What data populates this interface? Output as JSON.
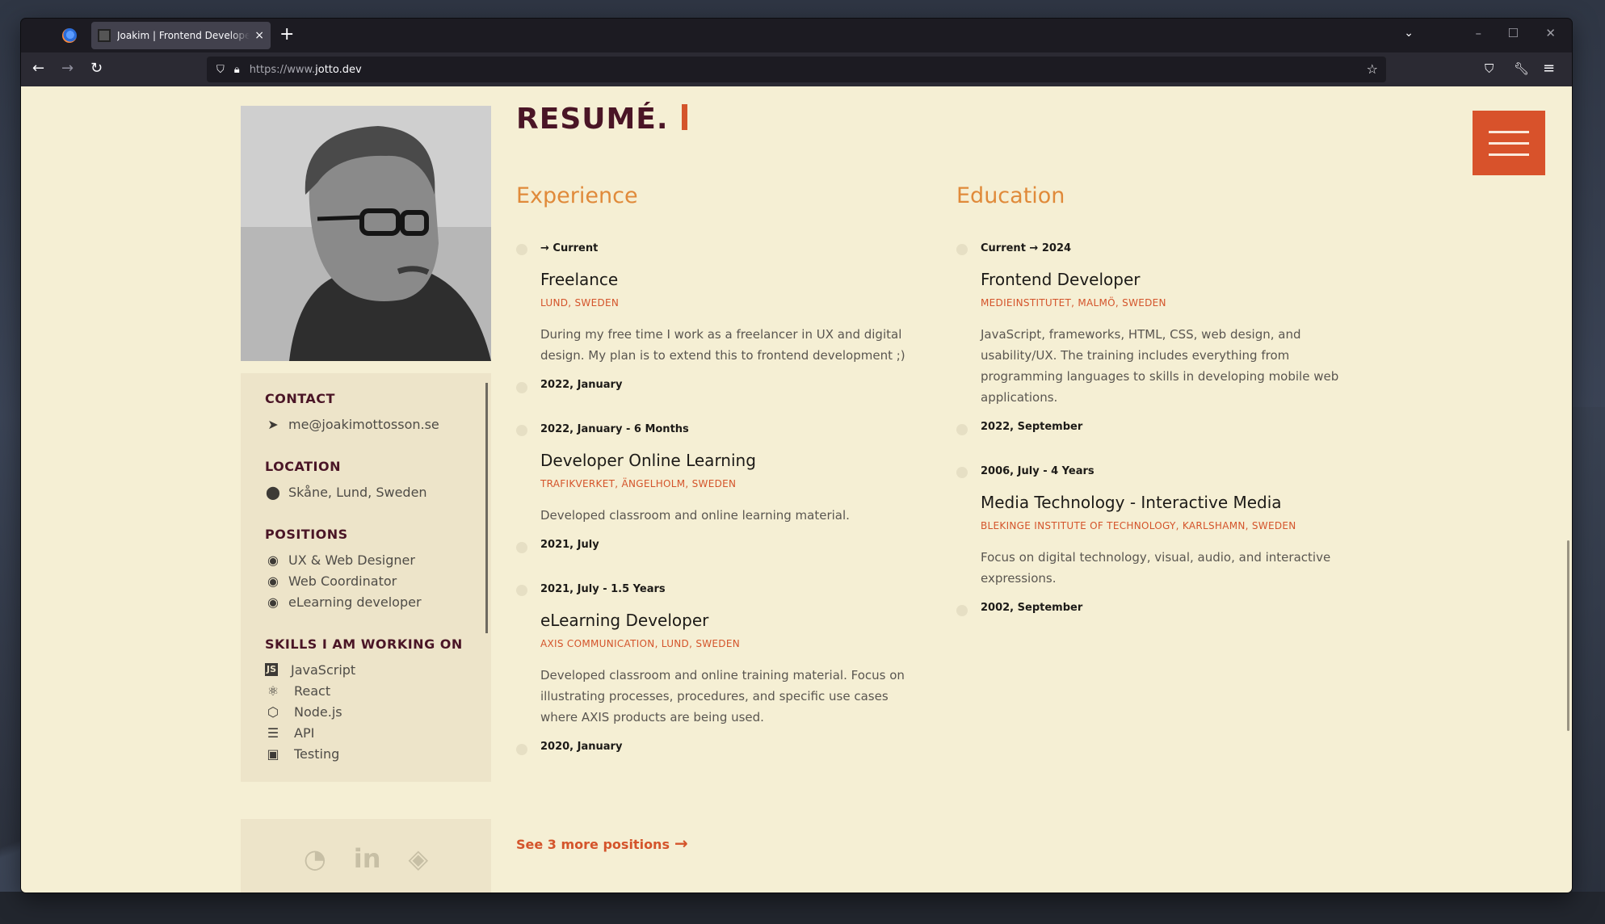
{
  "browser": {
    "tab_title": "Joakim | Frontend Developer studying",
    "tab_close": "×",
    "new_tab": "+",
    "url_prefix": "https://www.",
    "url_domain": "jotto.dev"
  },
  "resume": {
    "heading": "RESUMÉ."
  },
  "sidebar": {
    "contact": {
      "heading": "CONTACT",
      "email": "me@joakimottosson.se"
    },
    "location": {
      "heading": "LOCATION",
      "value": "Skåne, Lund, Sweden"
    },
    "positions": {
      "heading": "POSITIONS",
      "items": [
        "UX & Web Designer",
        "Web Coordinator",
        "eLearning developer"
      ]
    },
    "skills": {
      "heading": "SKILLS I AM WORKING ON",
      "items": [
        "JavaScript",
        "React",
        "Node.js",
        "API",
        "Testing"
      ]
    }
  },
  "experience": {
    "title": "Experience",
    "entries": [
      {
        "date": "→ Current",
        "role": "Freelance",
        "org": "LUND, SWEDEN",
        "desc": "During my free time I work as a freelancer in UX and digital design. My plan is to extend this to frontend development ;)",
        "end": "2022, January"
      },
      {
        "date": "2022, January - 6 Months",
        "role": "Developer Online Learning",
        "org": "TRAFIKVERKET, ÄNGELHOLM, SWEDEN",
        "desc": "Developed classroom and online learning material.",
        "end": "2021, July"
      },
      {
        "date": "2021, July - 1.5 Years",
        "role": "eLearning Developer",
        "org": "AXIS COMMUNICATION, LUND, SWEDEN",
        "desc": "Developed classroom and online training material. Focus on illustrating processes, procedures, and specific use cases where AXIS products are being used.",
        "end": "2020, January"
      }
    ],
    "more_link": "See 3 more positions"
  },
  "education": {
    "title": "Education",
    "entries": [
      {
        "date": "Current → 2024",
        "role": "Frontend Developer",
        "org": "MEDIEINSTITUTET, MALMÖ, SWEDEN",
        "desc": "JavaScript, frameworks, HTML, CSS, web design, and usability/UX. The training includes everything from programming languages to skills in developing mobile web applications.",
        "end": "2022, September"
      },
      {
        "date": "2006, July - 4 Years",
        "role": "Media Technology - Interactive Media",
        "org": "BLEKINGE INSTITUTE OF TECHNOLOGY, KARLSHAMN, SWEDEN",
        "desc": "Focus on digital technology, visual, audio, and interactive expressions.",
        "end": "2002, September"
      }
    ]
  },
  "colors": {
    "accent": "#d4542b",
    "heading": "#4a1526",
    "background": "#f5efd4",
    "section_title": "#e08a3a"
  },
  "icons": {
    "contact": "send-icon",
    "location": "pin-icon",
    "position": "target-icon",
    "skills": [
      "js-icon",
      "react-icon",
      "nodejs-icon",
      "database-icon",
      "robot-icon"
    ],
    "social": [
      "github-icon",
      "linkedin-icon",
      "codepen-icon"
    ]
  }
}
